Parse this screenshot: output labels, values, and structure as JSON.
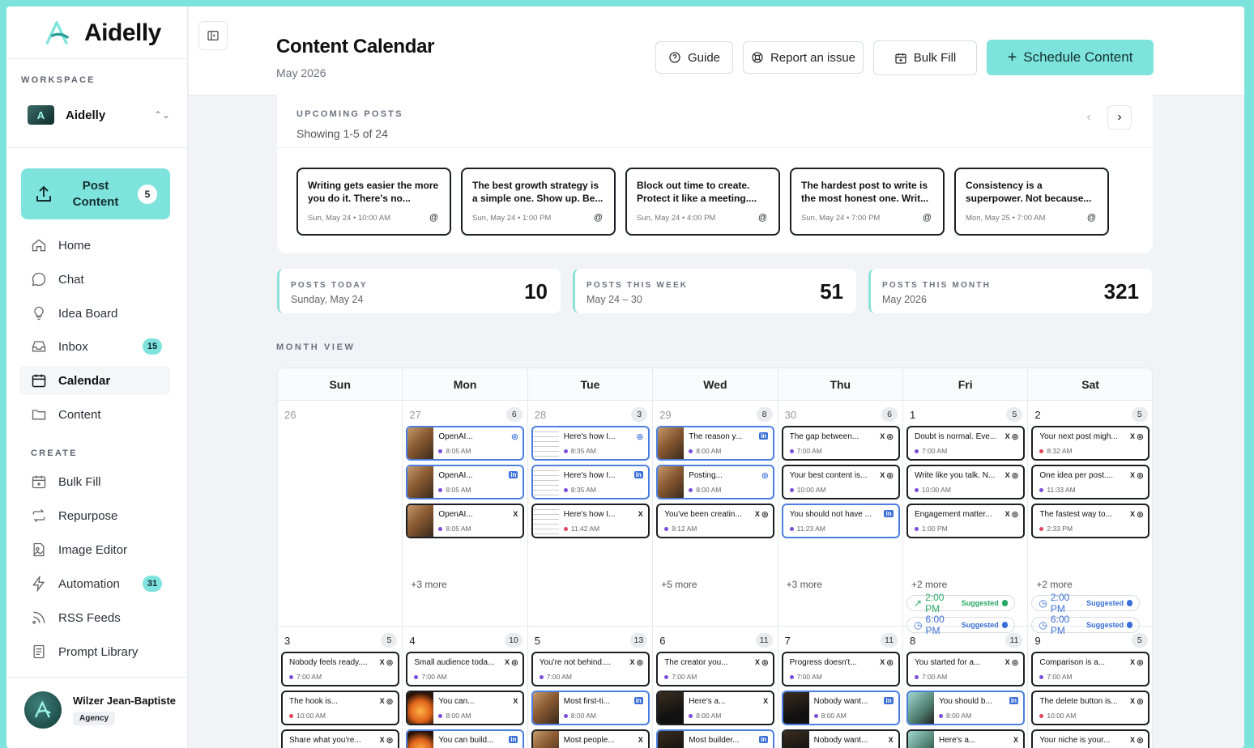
{
  "app": {
    "name": "Aidelly"
  },
  "sidebar": {
    "workspace_label": "WORKSPACE",
    "workspace_name": "Aidelly",
    "post_button": {
      "line1": "Post",
      "line2": "Content",
      "count": "5"
    },
    "nav": [
      {
        "label": "Home",
        "icon": "home-icon"
      },
      {
        "label": "Chat",
        "icon": "chat-icon"
      },
      {
        "label": "Idea Board",
        "icon": "lightbulb-icon"
      },
      {
        "label": "Inbox",
        "icon": "inbox-icon",
        "badge": "15"
      },
      {
        "label": "Calendar",
        "icon": "calendar-icon",
        "active": true
      },
      {
        "label": "Content",
        "icon": "folder-icon"
      }
    ],
    "create_label": "CREATE",
    "create": [
      {
        "label": "Bulk Fill",
        "icon": "calendar-plus-icon"
      },
      {
        "label": "Repurpose",
        "icon": "repeat-icon"
      },
      {
        "label": "Image Editor",
        "icon": "image-icon"
      },
      {
        "label": "Automation",
        "icon": "bolt-icon",
        "badge": "31"
      },
      {
        "label": "RSS Feeds",
        "icon": "rss-icon"
      },
      {
        "label": "Prompt Library",
        "icon": "book-icon"
      }
    ],
    "user": {
      "name": "Wilzer Jean-Baptiste",
      "role": "Agency"
    }
  },
  "header": {
    "title": "Content Calendar",
    "subtitle": "May 2026",
    "buttons": {
      "guide": "Guide",
      "report": "Report an issue",
      "bulk": "Bulk Fill",
      "schedule": "Schedule Content"
    }
  },
  "upcoming": {
    "label": "UPCOMING POSTS",
    "showing": "Showing 1-5 of 24",
    "posts": [
      {
        "text": "Writing gets easier the more you do it. There's no...",
        "meta": "Sun, May 24 • 10:00 AM"
      },
      {
        "text": "The best growth strategy is a simple one. Show up. Be...",
        "meta": "Sun, May 24 • 1:00 PM"
      },
      {
        "text": "Block out time to create. Protect it like a meeting....",
        "meta": "Sun, May 24 • 4:00 PM"
      },
      {
        "text": "The hardest post to write is the most honest one. Writ...",
        "meta": "Sun, May 24 • 7:00 PM"
      },
      {
        "text": "Consistency is a superpower. Not because...",
        "meta": "Mon, May 25 • 7:00 AM"
      }
    ]
  },
  "stats": [
    {
      "label": "POSTS TODAY",
      "sub": "Sunday, May 24",
      "value": "10"
    },
    {
      "label": "POSTS THIS WEEK",
      "sub": "May 24 – 30",
      "value": "51"
    },
    {
      "label": "POSTS THIS MONTH",
      "sub": "May 2026",
      "value": "321"
    }
  ],
  "month_view_label": "MONTH VIEW",
  "days": [
    "Sun",
    "Mon",
    "Tue",
    "Wed",
    "Thu",
    "Fri",
    "Sat"
  ],
  "colors": {
    "accent": "#7ee3dd",
    "purple_dot": "#7c4ddb",
    "red_dot": "#e0475b",
    "blue_border": "#4a7fe0",
    "green": "#27a862",
    "blue": "#3b6fd8"
  },
  "week1": [
    {
      "day": "26",
      "muted": true,
      "count": "",
      "events": [],
      "more": ""
    },
    {
      "day": "27",
      "muted": true,
      "count": "6",
      "events": [
        {
          "t": "OpenAI...",
          "m": "8:05 AM",
          "i": "◎",
          "thumb": true,
          "blue": true,
          "dot": "purple"
        },
        {
          "t": "OpenAI...",
          "m": "8:05 AM",
          "i": "in",
          "thumb": true,
          "blue": true,
          "dot": "purple"
        },
        {
          "t": "OpenAI...",
          "m": "8:05 AM",
          "i": "X",
          "thumb": true,
          "blue": false,
          "dot": "purple"
        }
      ],
      "more": "+3 more"
    },
    {
      "day": "28",
      "muted": true,
      "count": "3",
      "events": [
        {
          "t": "Here's how I...",
          "m": "8:35 AM",
          "i": "◎",
          "thumb": "doc",
          "blue": true,
          "dot": "purple"
        },
        {
          "t": "Here's how I...",
          "m": "8:35 AM",
          "i": "in",
          "thumb": "doc",
          "blue": true,
          "dot": "purple"
        },
        {
          "t": "Here's how I...",
          "m": "11:42 AM",
          "i": "X",
          "thumb": "doc",
          "blue": false,
          "dot": "red"
        }
      ],
      "more": ""
    },
    {
      "day": "29",
      "muted": true,
      "count": "8",
      "events": [
        {
          "t": "The reason y...",
          "m": "8:00 AM",
          "i": "in",
          "thumb": true,
          "blue": true,
          "dot": "purple"
        },
        {
          "t": "Posting...",
          "m": "8:00 AM",
          "i": "◎",
          "thumb": true,
          "blue": true,
          "dot": "purple"
        },
        {
          "t": "You've been creatin...",
          "m": "9:12 AM",
          "i": "X ◎",
          "thumb": false,
          "blue": false,
          "dot": "purple"
        }
      ],
      "more": "+5 more"
    },
    {
      "day": "30",
      "muted": true,
      "count": "6",
      "events": [
        {
          "t": "The gap between...",
          "m": "7:00 AM",
          "i": "X ◎",
          "thumb": false,
          "blue": false,
          "dot": "purple"
        },
        {
          "t": "Your best content is...",
          "m": "10:00 AM",
          "i": "X ◎",
          "thumb": false,
          "blue": false,
          "dot": "purple"
        },
        {
          "t": "You should not have ...",
          "m": "11:23 AM",
          "i": "in",
          "thumb": false,
          "blue": true,
          "dot": "purple"
        }
      ],
      "more": "+3 more"
    },
    {
      "day": "1",
      "muted": false,
      "count": "5",
      "events": [
        {
          "t": "Doubt is normal. Eve...",
          "m": "7:00 AM",
          "i": "X ◎",
          "thumb": false,
          "blue": false,
          "dot": "purple"
        },
        {
          "t": "Write like you talk. N...",
          "m": "10:00 AM",
          "i": "X ◎",
          "thumb": false,
          "blue": false,
          "dot": "purple"
        },
        {
          "t": "Engagement matter...",
          "m": "1:00 PM",
          "i": "X ◎",
          "thumb": false,
          "blue": false,
          "dot": "purple"
        }
      ],
      "more": "+2 more",
      "suggested": [
        {
          "time": "2:00 PM",
          "tag": "Suggested",
          "color": "green",
          "icon": "↗"
        },
        {
          "time": "6:00 PM",
          "tag": "Suggested",
          "color": "blue",
          "icon": "◷"
        }
      ]
    },
    {
      "day": "2",
      "muted": false,
      "count": "5",
      "events": [
        {
          "t": "Your next post migh...",
          "m": "8:32 AM",
          "i": "X ◎",
          "thumb": false,
          "blue": false,
          "dot": "red"
        },
        {
          "t": "One idea per post....",
          "m": "11:33 AM",
          "i": "X ◎",
          "thumb": false,
          "blue": false,
          "dot": "purple"
        },
        {
          "t": "The fastest way to...",
          "m": "2:33 PM",
          "i": "X ◎",
          "thumb": false,
          "blue": false,
          "dot": "red"
        }
      ],
      "more": "+2 more",
      "suggested": [
        {
          "time": "2:00 PM",
          "tag": "Suggested",
          "color": "blue",
          "icon": "◷"
        },
        {
          "time": "6:00 PM",
          "tag": "Suggested",
          "color": "blue",
          "icon": "◷"
        }
      ]
    }
  ],
  "week2": [
    {
      "day": "3",
      "count": "5",
      "events": [
        {
          "t": "Nobody feels ready....",
          "m": "7:00 AM",
          "i": "X ◎",
          "thumb": false,
          "blue": false,
          "dot": "purple"
        },
        {
          "t": "The hook is...",
          "m": "10:00 AM",
          "i": "X ◎",
          "thumb": false,
          "blue": false,
          "dot": "red"
        },
        {
          "t": "Share what you're...",
          "m": "",
          "i": "X ◎",
          "thumb": false,
          "blue": false,
          "dot": "purple"
        }
      ]
    },
    {
      "day": "4",
      "count": "10",
      "events": [
        {
          "t": "Small audience toda...",
          "m": "7:00 AM",
          "i": "X ◎",
          "thumb": false,
          "blue": false,
          "dot": "purple"
        },
        {
          "t": "You can...",
          "m": "8:00 AM",
          "i": "X",
          "thumb": "fire",
          "blue": false,
          "dot": "purple"
        },
        {
          "t": "You can build...",
          "m": "",
          "i": "in",
          "thumb": "fire",
          "blue": true,
          "dot": "purple"
        }
      ]
    },
    {
      "day": "5",
      "count": "13",
      "events": [
        {
          "t": "You're not behind....",
          "m": "7:00 AM",
          "i": "X ◎",
          "thumb": false,
          "blue": false,
          "dot": "purple"
        },
        {
          "t": "Most first-ti...",
          "m": "8:00 AM",
          "i": "in",
          "thumb": true,
          "blue": true,
          "dot": "purple"
        },
        {
          "t": "Most people...",
          "m": "",
          "i": "X",
          "thumb": true,
          "blue": false,
          "dot": "purple"
        }
      ]
    },
    {
      "day": "6",
      "count": "11",
      "events": [
        {
          "t": "The creator you...",
          "m": "7:00 AM",
          "i": "X ◎",
          "thumb": false,
          "blue": false,
          "dot": "purple"
        },
        {
          "t": "Here's a...",
          "m": "8:00 AM",
          "i": "X",
          "thumb": "dark",
          "blue": false,
          "dot": "purple"
        },
        {
          "t": "Most builder...",
          "m": "",
          "i": "in",
          "thumb": "dark",
          "blue": true,
          "dot": "purple"
        }
      ]
    },
    {
      "day": "7",
      "count": "11",
      "events": [
        {
          "t": "Progress doesn't...",
          "m": "7:00 AM",
          "i": "X ◎",
          "thumb": false,
          "blue": false,
          "dot": "purple"
        },
        {
          "t": "Nobody want...",
          "m": "8:00 AM",
          "i": "in",
          "thumb": "dark",
          "blue": true,
          "dot": "purple"
        },
        {
          "t": "Nobody want...",
          "m": "",
          "i": "X",
          "thumb": "dark",
          "blue": false,
          "dot": "purple"
        }
      ]
    },
    {
      "day": "8",
      "count": "11",
      "events": [
        {
          "t": "You started for a...",
          "m": "7:00 AM",
          "i": "X ◎",
          "thumb": false,
          "blue": false,
          "dot": "purple"
        },
        {
          "t": "You should b...",
          "m": "8:00 AM",
          "i": "in",
          "thumb": "teal",
          "blue": true,
          "dot": "purple"
        },
        {
          "t": "Here's a...",
          "m": "",
          "i": "X",
          "thumb": "teal",
          "blue": false,
          "dot": "purple"
        }
      ]
    },
    {
      "day": "9",
      "count": "5",
      "events": [
        {
          "t": "Comparison is a...",
          "m": "7:00 AM",
          "i": "X ◎",
          "thumb": false,
          "blue": false,
          "dot": "purple"
        },
        {
          "t": "The delete button is...",
          "m": "10:00 AM",
          "i": "X ◎",
          "thumb": false,
          "blue": false,
          "dot": "red"
        },
        {
          "t": "Your niche is your...",
          "m": "",
          "i": "X ◎",
          "thumb": false,
          "blue": false,
          "dot": "purple"
        }
      ]
    }
  ]
}
